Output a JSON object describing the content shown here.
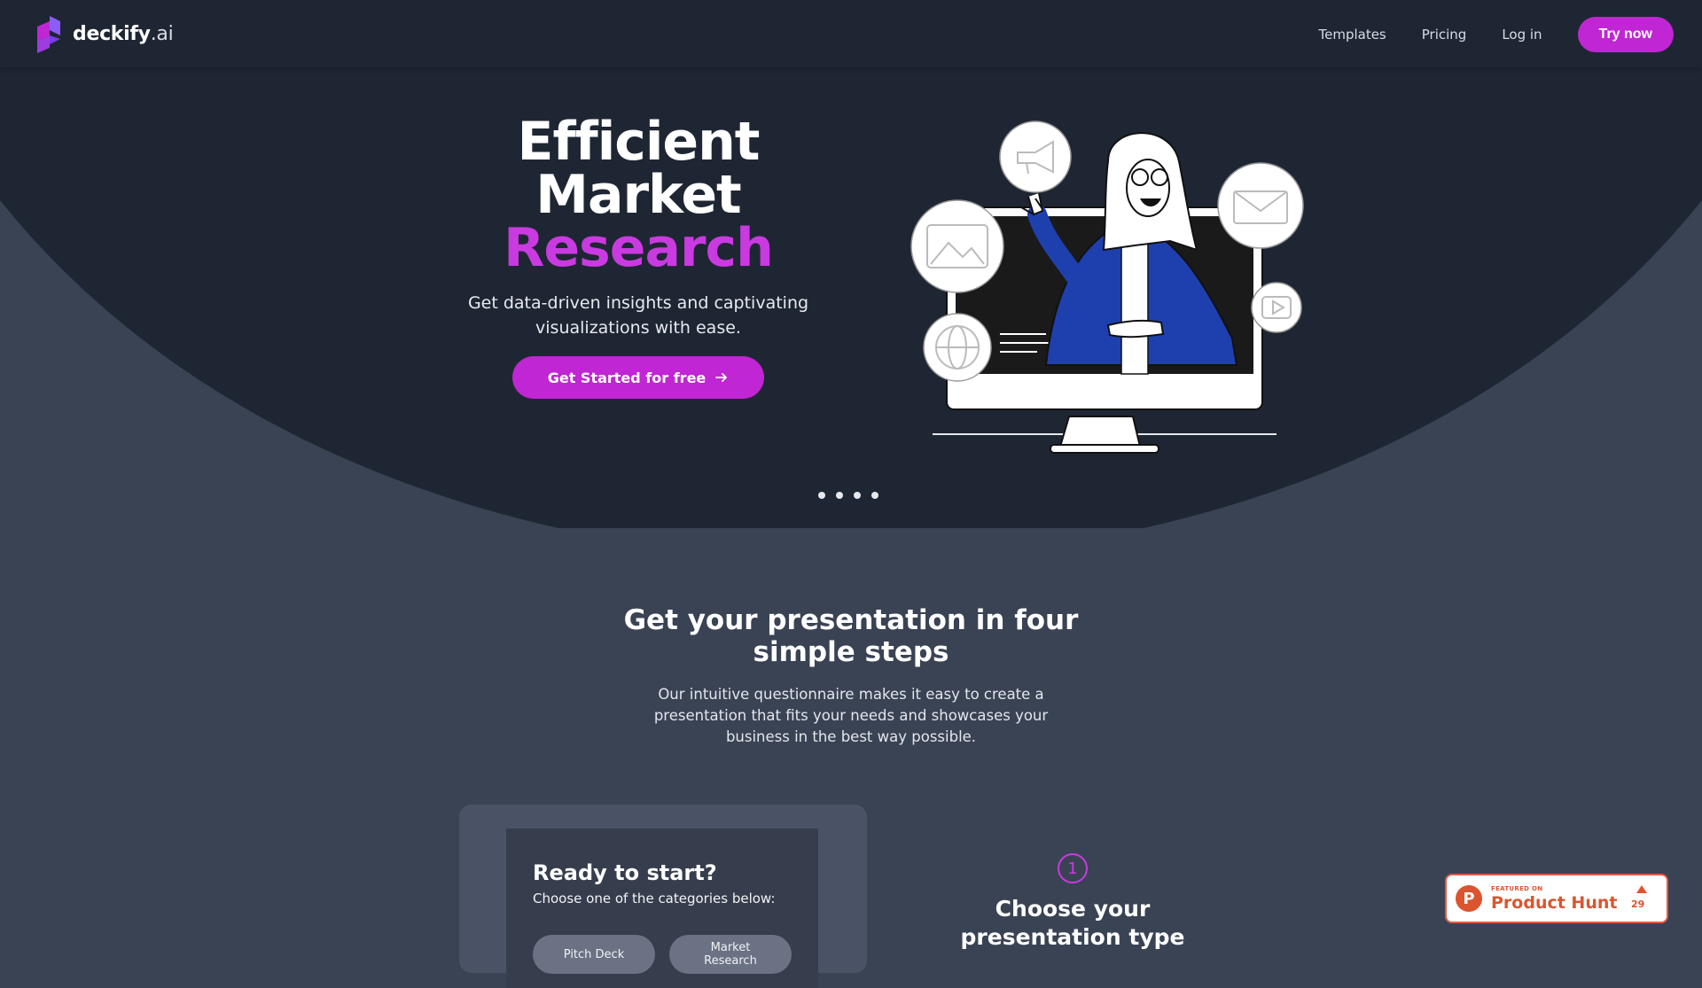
{
  "brand": {
    "name": "deckify",
    "tld": ".ai"
  },
  "nav": {
    "links": [
      "Templates",
      "Pricing",
      "Log in"
    ],
    "cta": "Try now"
  },
  "hero": {
    "title_line1": "Efficient",
    "title_line2": "Market",
    "title_accent": "Research",
    "subtitle": "Get data-driven insights and captivating visualizations with ease.",
    "cta": "Get Started for free",
    "slide_count": 4
  },
  "steps": {
    "title": "Get your presentation in four simple steps",
    "subtitle": "Our intuitive questionnaire makes it easy to create a presentation that fits your needs and showcases your business in the best way possible.",
    "card": {
      "title": "Ready to start?",
      "subtitle": "Choose one of the categories below:",
      "chips": [
        "Pitch Deck",
        "Market Research"
      ]
    },
    "step1": {
      "number": "1",
      "title": "Choose your presentation type"
    }
  },
  "badge": {
    "small": "FEATURED ON",
    "big": "Product Hunt",
    "letter": "P",
    "count": "29"
  },
  "colors": {
    "accent": "#c026d3",
    "accent_text": "#c93ae0",
    "header_bg": "#1f2633",
    "hero_bg": "#1f2633",
    "page_bg": "#3a4354",
    "product_hunt": "#da552f"
  }
}
